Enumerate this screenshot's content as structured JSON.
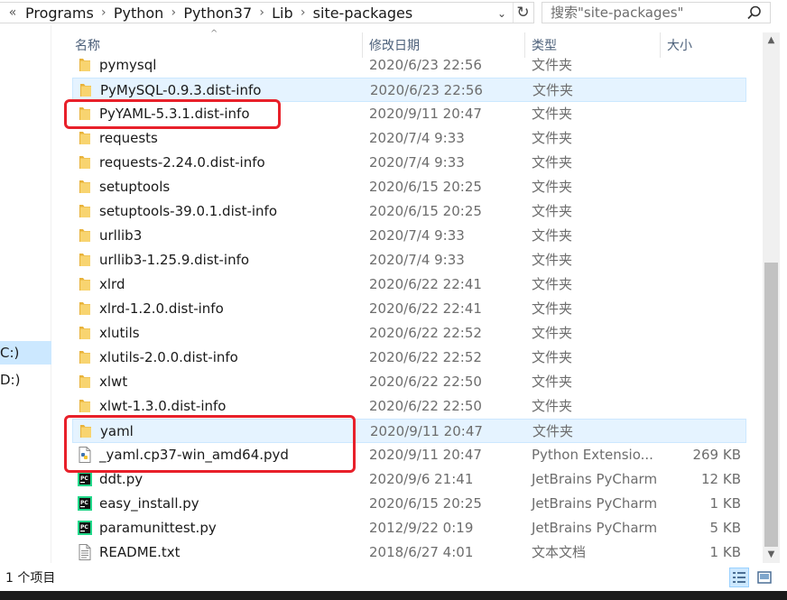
{
  "address_bar": {
    "lead": "«",
    "crumbs": [
      "Programs",
      "Python",
      "Python37",
      "Lib",
      "site-packages"
    ],
    "dropdown_icon": "chevron-down-icon",
    "refresh_icon": "refresh-icon"
  },
  "search": {
    "placeholder": "搜索\"site-packages\"",
    "icon": "search-icon"
  },
  "nav": {
    "items": [
      {
        "label": "C:)",
        "selected": true
      },
      {
        "label": "D:)",
        "selected": false
      }
    ]
  },
  "columns": {
    "name": "名称",
    "date": "修改日期",
    "type": "类型",
    "size": "大小",
    "sort_indicator": "^"
  },
  "files": [
    {
      "name": "pymysql",
      "date": "2020/6/23 22:56",
      "type": "文件夹",
      "size": "",
      "icon": "folder-icon"
    },
    {
      "name": "PyMySQL-0.9.3.dist-info",
      "date": "2020/6/23 22:56",
      "type": "文件夹",
      "size": "",
      "icon": "folder-icon"
    },
    {
      "name": "PyYAML-5.3.1.dist-info",
      "date": "2020/9/11 20:47",
      "type": "文件夹",
      "size": "",
      "icon": "folder-icon"
    },
    {
      "name": "requests",
      "date": "2020/7/4 9:33",
      "type": "文件夹",
      "size": "",
      "icon": "folder-icon"
    },
    {
      "name": "requests-2.24.0.dist-info",
      "date": "2020/7/4 9:33",
      "type": "文件夹",
      "size": "",
      "icon": "folder-icon"
    },
    {
      "name": "setuptools",
      "date": "2020/6/15 20:25",
      "type": "文件夹",
      "size": "",
      "icon": "folder-icon"
    },
    {
      "name": "setuptools-39.0.1.dist-info",
      "date": "2020/6/15 20:25",
      "type": "文件夹",
      "size": "",
      "icon": "folder-icon"
    },
    {
      "name": "urllib3",
      "date": "2020/7/4 9:33",
      "type": "文件夹",
      "size": "",
      "icon": "folder-icon"
    },
    {
      "name": "urllib3-1.25.9.dist-info",
      "date": "2020/7/4 9:33",
      "type": "文件夹",
      "size": "",
      "icon": "folder-icon"
    },
    {
      "name": "xlrd",
      "date": "2020/6/22 22:41",
      "type": "文件夹",
      "size": "",
      "icon": "folder-icon"
    },
    {
      "name": "xlrd-1.2.0.dist-info",
      "date": "2020/6/22 22:41",
      "type": "文件夹",
      "size": "",
      "icon": "folder-icon"
    },
    {
      "name": "xlutils",
      "date": "2020/6/22 22:52",
      "type": "文件夹",
      "size": "",
      "icon": "folder-icon"
    },
    {
      "name": "xlutils-2.0.0.dist-info",
      "date": "2020/6/22 22:52",
      "type": "文件夹",
      "size": "",
      "icon": "folder-icon"
    },
    {
      "name": "xlwt",
      "date": "2020/6/22 22:50",
      "type": "文件夹",
      "size": "",
      "icon": "folder-icon"
    },
    {
      "name": "xlwt-1.3.0.dist-info",
      "date": "2020/6/22 22:50",
      "type": "文件夹",
      "size": "",
      "icon": "folder-icon"
    },
    {
      "name": "yaml",
      "date": "2020/9/11 20:47",
      "type": "文件夹",
      "size": "",
      "icon": "folder-icon"
    },
    {
      "name": "_yaml.cp37-win_amd64.pyd",
      "date": "2020/9/11 20:47",
      "type": "Python Extensio...",
      "size": "269 KB",
      "icon": "python-file-icon"
    },
    {
      "name": "ddt.py",
      "date": "2020/9/6 21:41",
      "type": "JetBrains PyCharm",
      "size": "12 KB",
      "icon": "pycharm-file-icon"
    },
    {
      "name": "easy_install.py",
      "date": "2020/6/15 20:25",
      "type": "JetBrains PyCharm",
      "size": "1 KB",
      "icon": "pycharm-file-icon"
    },
    {
      "name": "paramunittest.py",
      "date": "2012/9/22 0:19",
      "type": "JetBrains PyCharm",
      "size": "5 KB",
      "icon": "pycharm-file-icon"
    },
    {
      "name": "README.txt",
      "date": "2018/6/27 4:01",
      "type": "文本文档",
      "size": "1 KB",
      "icon": "text-file-icon"
    }
  ],
  "status": {
    "selection_text": "1 个项目"
  },
  "colors": {
    "selection_bg": "#cce8ff",
    "hover_bg": "#e5f3ff",
    "highlight_box": "#e8202a",
    "folder": "#f6c745"
  }
}
